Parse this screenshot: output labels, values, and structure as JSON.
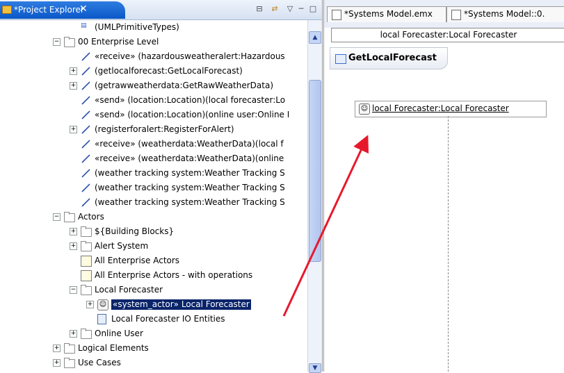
{
  "left_view": {
    "tab_title": "*Project Explorer",
    "tab_close": "✕",
    "buttons": {
      "collapse": "⊟",
      "link": "⇄",
      "menu": "▽",
      "minimize": "─",
      "maximize": "□"
    },
    "tree": [
      {
        "depth": 3,
        "icon": "uml-primitive-icon",
        "label": "(UMLPrimitiveTypes)",
        "expander": ""
      },
      {
        "depth": 2,
        "icon": "folder-icon",
        "label": "00 Enterprise Level",
        "expander": "−"
      },
      {
        "depth": 3,
        "icon": "relationship-icon",
        "label": "«receive» (hazardousweatheralert:Hazardous",
        "expander": ""
      },
      {
        "depth": 3,
        "icon": "relationship-icon",
        "label": "(getlocalforecast:GetLocalForecast)",
        "expander": "+"
      },
      {
        "depth": 3,
        "icon": "relationship-icon",
        "label": "(getrawweatherdata:GetRawWeatherData)",
        "expander": "+"
      },
      {
        "depth": 3,
        "icon": "relationship-icon",
        "label": "«send» (location:Location)(local forecaster:Lo",
        "expander": ""
      },
      {
        "depth": 3,
        "icon": "relationship-icon",
        "label": "«send» (location:Location)(online user:Online I",
        "expander": ""
      },
      {
        "depth": 3,
        "icon": "relationship-icon",
        "label": "(registerforalert:RegisterForAlert)",
        "expander": "+"
      },
      {
        "depth": 3,
        "icon": "relationship-icon",
        "label": "«receive» (weatherdata:WeatherData)(local f",
        "expander": ""
      },
      {
        "depth": 3,
        "icon": "relationship-icon",
        "label": "«receive» (weatherdata:WeatherData)(online",
        "expander": ""
      },
      {
        "depth": 3,
        "icon": "relationship-icon",
        "label": "(weather tracking system:Weather Tracking S",
        "expander": ""
      },
      {
        "depth": 3,
        "icon": "relationship-icon",
        "label": "(weather tracking system:Weather Tracking S",
        "expander": ""
      },
      {
        "depth": 3,
        "icon": "relationship-icon",
        "label": "(weather tracking system:Weather Tracking S",
        "expander": ""
      },
      {
        "depth": 2,
        "icon": "folder-icon",
        "label": "Actors",
        "expander": "−"
      },
      {
        "depth": 3,
        "icon": "folder-icon",
        "label": "${Building Blocks}",
        "expander": "+"
      },
      {
        "depth": 3,
        "icon": "folder-icon",
        "label": "Alert System",
        "expander": "+"
      },
      {
        "depth": 3,
        "icon": "diagram-icon",
        "label": "All Enterprise Actors",
        "expander": ""
      },
      {
        "depth": 3,
        "icon": "diagram-icon",
        "label": "All Enterprise Actors - with operations",
        "expander": ""
      },
      {
        "depth": 3,
        "icon": "folder-icon",
        "label": "Local Forecaster",
        "expander": "−"
      },
      {
        "depth": 4,
        "icon": "actor-icon",
        "label": "«system_actor» Local Forecaster",
        "expander": "+",
        "selected": true
      },
      {
        "depth": 4,
        "icon": "document-icon",
        "label": "Local Forecaster IO Entities",
        "expander": ""
      },
      {
        "depth": 3,
        "icon": "folder-icon",
        "label": "Online User",
        "expander": "+"
      },
      {
        "depth": 2,
        "icon": "folder-icon",
        "label": "Logical Elements",
        "expander": "+"
      },
      {
        "depth": 2,
        "icon": "folder-icon",
        "label": "Use Cases",
        "expander": "+"
      }
    ]
  },
  "right_view": {
    "tabs": [
      {
        "label": "*Systems Model.emx"
      },
      {
        "label": "*Systems Model::0."
      }
    ],
    "breadcrumb": "local Forecaster:Local Forecaster",
    "diagram_title": "GetLocalForecast",
    "lifeline_label": "local Forecaster:Local Forecaster"
  },
  "annotation": {
    "arrow_color": "#e8182c"
  },
  "colors": {
    "selection": "#0a246a",
    "tab_active": "#0a58c8"
  }
}
